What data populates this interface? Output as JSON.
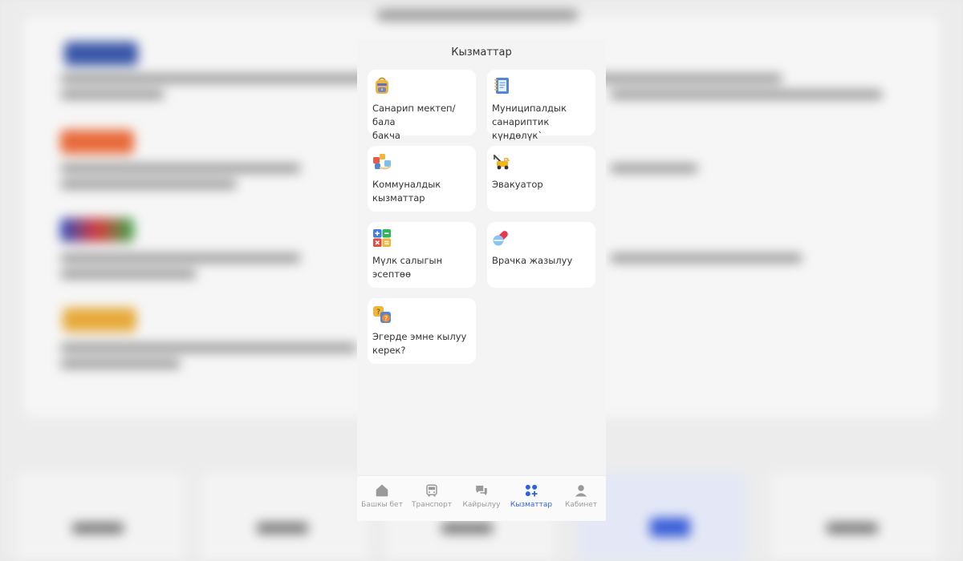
{
  "header": {
    "title": "Кызматтар"
  },
  "services": [
    {
      "label": "Санарип мектеп/бала\nбакча",
      "icon": "backpack-icon"
    },
    {
      "label": "Муниципалдык\nсанариптик күндөлүк`",
      "icon": "notebook-icon"
    },
    {
      "label": "Коммуналдык\nкызматтар",
      "icon": "utilities-icon"
    },
    {
      "label": "Эвакуатор",
      "icon": "tow-truck-icon"
    },
    {
      "label": "Мүлк салыгын\nэсептөө",
      "icon": "calculator-icon"
    },
    {
      "label": "Врачка жазылуу",
      "icon": "pills-icon"
    },
    {
      "label": "Эгерде эмне кылуу\nкерек?",
      "icon": "question-bubbles-icon"
    }
  ],
  "nav": {
    "active": "Кызматтар",
    "items": [
      {
        "label": "Башкы бет",
        "icon": "home-icon"
      },
      {
        "label": "Транспорт",
        "icon": "bus-icon"
      },
      {
        "label": "Кайрылуу",
        "icon": "chat-icon"
      },
      {
        "label": "Кызматтар",
        "icon": "services-grid-icon"
      },
      {
        "label": "Кабинет",
        "icon": "user-icon"
      }
    ]
  },
  "colors": {
    "accent": "#2b62e6",
    "screen_background": "#f4f4f4",
    "card_background": "#ffffff",
    "inactive_nav": "#9a9a9a"
  }
}
